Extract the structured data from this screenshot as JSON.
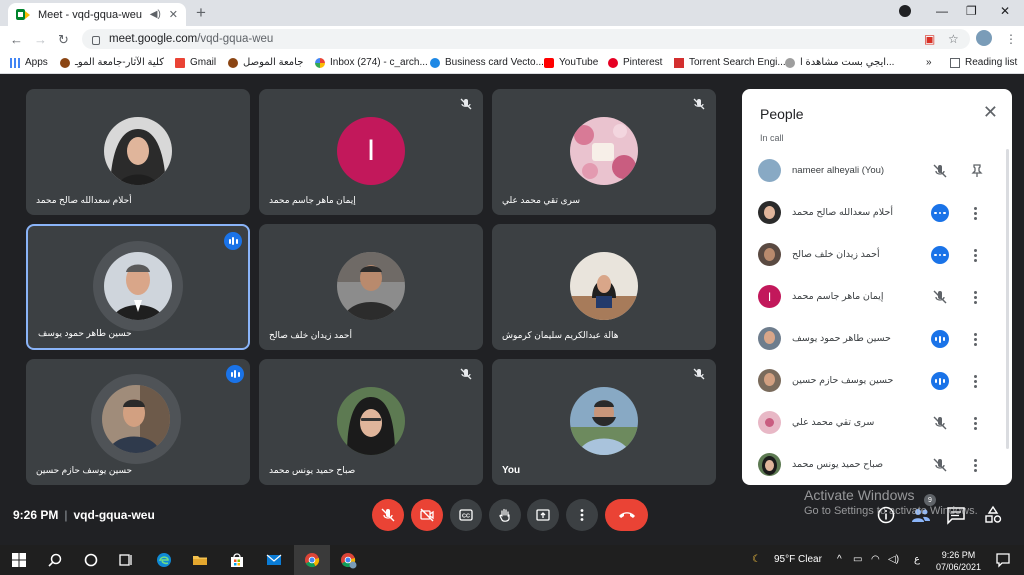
{
  "browser": {
    "tab_title": "Meet - vqd-gqua-weu",
    "new_tab": "+",
    "url_host": "meet.google.com",
    "url_path": "/vqd-gqua-weu",
    "bookmarks": [
      {
        "label": "Apps",
        "icon": "apps-grid-icon",
        "color": "#4285f4"
      },
      {
        "label": "كلية الآثار-جامعة الموـ",
        "icon": "college-logo-icon",
        "color": "#8b4513"
      },
      {
        "label": "Gmail",
        "icon": "gmail-icon",
        "color": "#ea4335"
      },
      {
        "label": "جامعة الموصل",
        "icon": "university-logo-icon",
        "color": "#8b4513"
      },
      {
        "label": "Inbox (274) - c_arch...",
        "icon": "google-icon",
        "color": "#4285f4"
      },
      {
        "label": "Business card Vecto...",
        "icon": "vector-icon",
        "color": "#1e88e5"
      },
      {
        "label": "YouTube",
        "icon": "youtube-icon",
        "color": "#ff0000"
      },
      {
        "label": "Pinterest",
        "icon": "pinterest-icon",
        "color": "#e60023"
      },
      {
        "label": "Torrent Search Engi...",
        "icon": "torrent-icon",
        "color": "#d32f2f"
      },
      {
        "label": "ايجي بست مشاهدة ا...",
        "icon": "egybest-icon",
        "color": "#9e9e9e"
      }
    ],
    "more": "»",
    "reading_list": "Reading list"
  },
  "meeting": {
    "time": "9:26 PM",
    "separator": "|",
    "code": "vqd-gqua-weu",
    "tiles": [
      {
        "name": "أحلام سعدالله صالح محمد",
        "mic": "none",
        "avatar_color": "#2b2b2b",
        "skin": "#e0b59b",
        "hijab": true
      },
      {
        "name": "إيمان ماهر جاسم محمد",
        "mic": "muted",
        "letter": "I",
        "avatar_color": "#c2185b"
      },
      {
        "name": "سرى تقي محمد علي",
        "mic": "muted",
        "avatar_color": "#e8b8c6",
        "photo": "flowers"
      },
      {
        "name": "حسين طاهر حمود يوسف",
        "mic": "speaking",
        "avatar_color": "#cfd5dc",
        "skin": "#d9a689",
        "active": true
      },
      {
        "name": "أحمد زيدان خلف صالح",
        "mic": "none",
        "avatar_color": "#8c8c8c",
        "skin": "#b98a6d"
      },
      {
        "name": "هالة عبدالكريم سليمان كرموش",
        "mic": "none",
        "avatar_color": "#e9e4dc",
        "skin": "#d9a689",
        "hijab": true
      },
      {
        "name": "حسين يوسف حازم حسين",
        "mic": "speaking",
        "avatar_color": "#a08c7a",
        "skin": "#d2a081"
      },
      {
        "name": "صباح حميد يونس محمد",
        "mic": "muted",
        "avatar_color": "#5d7a52",
        "skin": "#e0b59b",
        "hijab": true
      },
      {
        "name": "You",
        "mic": "muted",
        "avatar_color": "#88a9c4",
        "skin": "#c8967a",
        "bold": true
      }
    ]
  },
  "people": {
    "title": "People",
    "section": "In call",
    "members": [
      {
        "name": "nameer alheyali (You)",
        "action": "mic-off",
        "extra": "pin",
        "avatar_color": "#88a9c4"
      },
      {
        "name": "أحلام سعدالله صالح محمد",
        "action": "dots-blue",
        "extra": "more",
        "avatar_color": "#2b2b2b"
      },
      {
        "name": "أحمد زيدان خلف صالح",
        "action": "dots-blue",
        "extra": "more",
        "avatar_color": "#5a4a42"
      },
      {
        "name": "إيمان ماهر جاسم محمد",
        "action": "mic-off",
        "extra": "more",
        "letter": "I",
        "avatar_color": "#c2185b"
      },
      {
        "name": "حسين طاهر حمود يوسف",
        "action": "bars-blue",
        "extra": "more",
        "avatar_color": "#6e7d8d"
      },
      {
        "name": "حسين يوسف حازم حسين",
        "action": "bars-blue",
        "extra": "more",
        "avatar_color": "#7a6b5c"
      },
      {
        "name": "سرى تقي محمد علي",
        "action": "mic-off",
        "extra": "more",
        "avatar_color": "#e8b8c6"
      },
      {
        "name": "صباح حميد يونس محمد",
        "action": "mic-off",
        "extra": "more",
        "avatar_color": "#5d7a52"
      }
    ]
  },
  "right_controls": {
    "badge": "9"
  },
  "watermark": {
    "line1": "Activate Windows",
    "line2": "Go to Settings to activate Windows."
  },
  "taskbar": {
    "weather": "95°F  Clear",
    "lang": "ع",
    "time": "9:26 PM",
    "date": "07/06/2021"
  },
  "colors": {
    "accent": "#1a73e8",
    "danger": "#ea4335",
    "tile": "#3c4043",
    "bg": "#202124"
  }
}
